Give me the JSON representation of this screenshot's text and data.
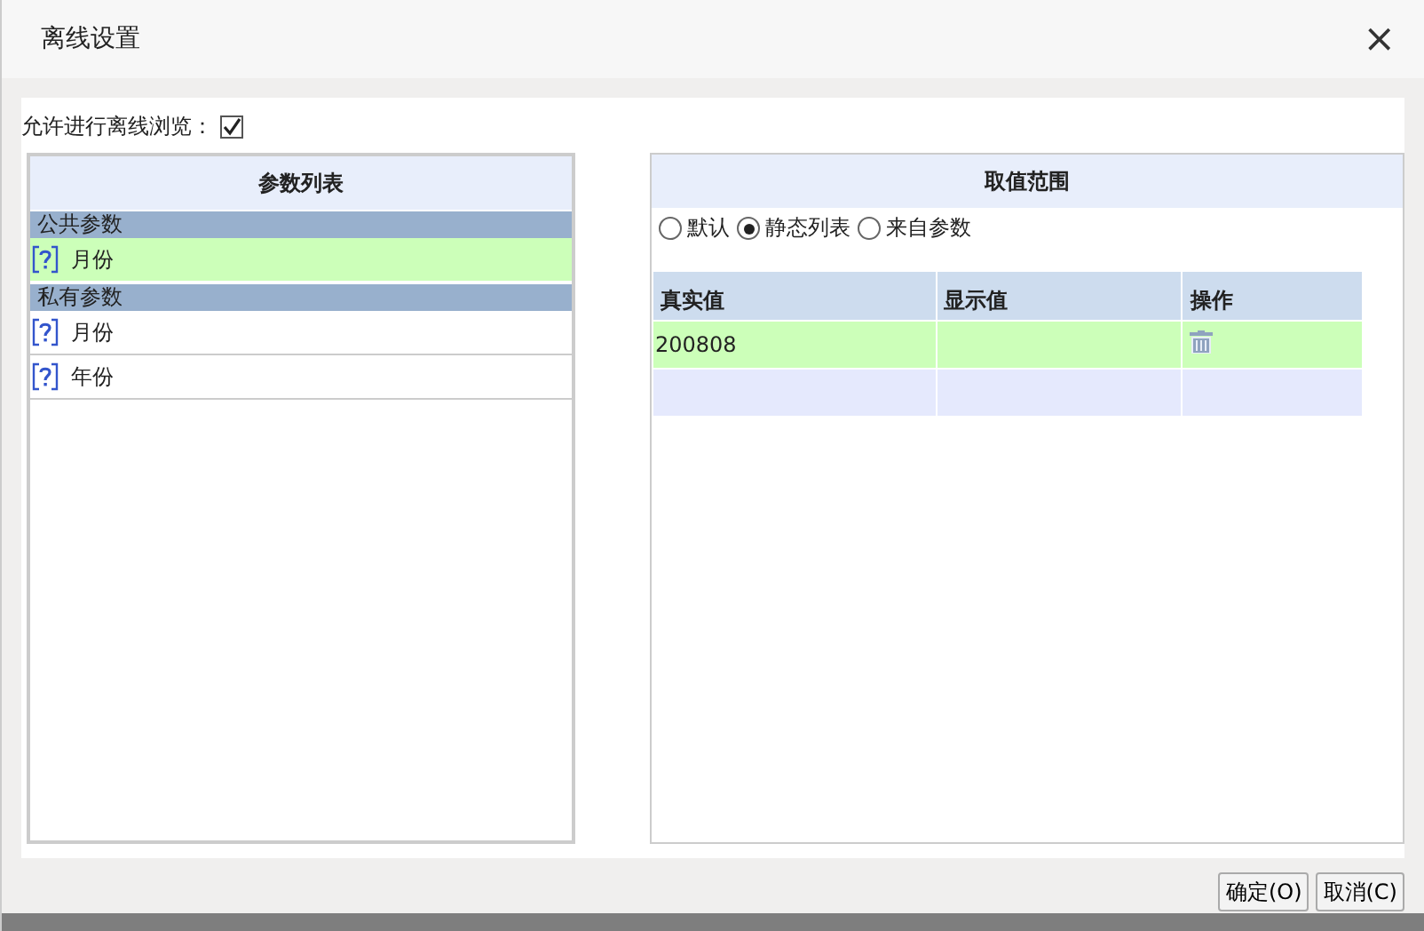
{
  "window": {
    "title": "离线设置",
    "close": "×"
  },
  "offline": {
    "label": "允许进行离线浏览：",
    "checked": true
  },
  "param_list": {
    "title": "参数列表",
    "groups": [
      {
        "label": "公共参数",
        "items": [
          {
            "label": "月份",
            "selected": true
          }
        ]
      },
      {
        "label": "私有参数",
        "items": [
          {
            "label": "月份",
            "selected": false
          },
          {
            "label": "年份",
            "selected": false
          }
        ]
      }
    ]
  },
  "value_range": {
    "title": "取值范围",
    "options": [
      {
        "label": "默认",
        "selected": false
      },
      {
        "label": "静态列表",
        "selected": true
      },
      {
        "label": "来自参数",
        "selected": false
      }
    ],
    "table": {
      "columns": [
        "真实值",
        "显示值",
        "操作"
      ],
      "rows": [
        {
          "real": "200808",
          "selected": true
        }
      ]
    }
  },
  "buttons": [
    "确定(O)",
    "取消(C)"
  ]
}
